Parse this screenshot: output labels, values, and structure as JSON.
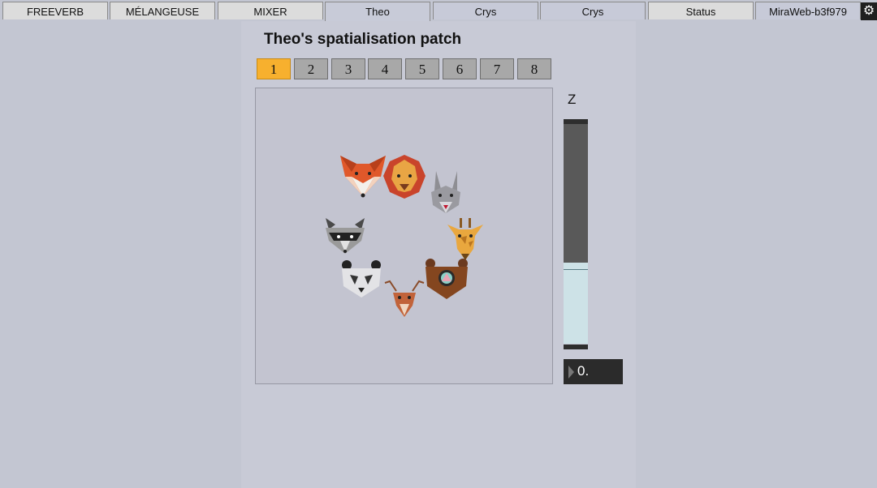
{
  "tabs": [
    {
      "label": "FREEVERB"
    },
    {
      "label": "MÉLANGEUSE"
    },
    {
      "label": "MIXER"
    },
    {
      "label": "Theo"
    },
    {
      "label": "Crys"
    },
    {
      "label": "Crys"
    },
    {
      "label": "Status"
    },
    {
      "label": "MiraWeb-b3f979"
    }
  ],
  "active_tab": "Theo",
  "settings_icon": "gear-icon",
  "patch": {
    "title": "Theo's spatialisation patch",
    "presets": [
      "1",
      "2",
      "3",
      "4",
      "5",
      "6",
      "7",
      "8"
    ],
    "active_preset": "1",
    "sources": [
      {
        "name": "fox-icon"
      },
      {
        "name": "lion-icon"
      },
      {
        "name": "rabbit-icon"
      },
      {
        "name": "giraffe-icon"
      },
      {
        "name": "bear-icon"
      },
      {
        "name": "deer-icon"
      },
      {
        "name": "panda-icon"
      },
      {
        "name": "raccoon-icon"
      }
    ],
    "z_label": "Z",
    "z_value": "0.",
    "z_slider_level": 0.35
  },
  "colors": {
    "accent": "#f7b02e",
    "slider_dark": "#595959",
    "slider_light": "#cde2e7"
  }
}
